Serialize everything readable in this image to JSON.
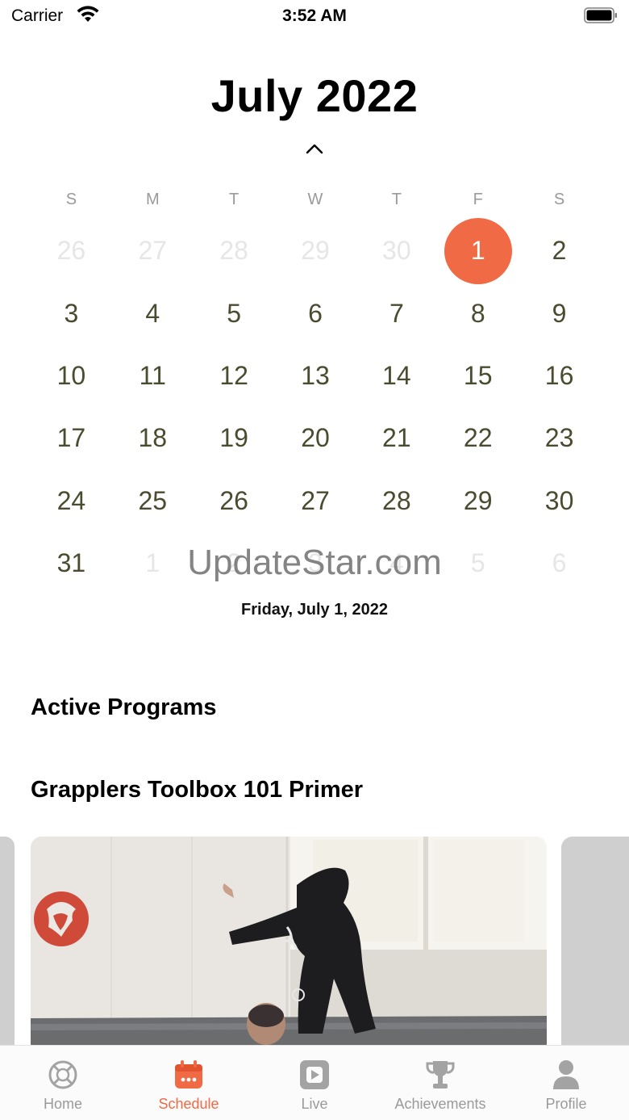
{
  "status_bar": {
    "carrier": "Carrier",
    "time": "3:52 AM"
  },
  "calendar": {
    "month_title": "July 2022",
    "weekdays": [
      "S",
      "M",
      "T",
      "W",
      "T",
      "F",
      "S"
    ],
    "days": [
      {
        "label": "26",
        "in_month": false
      },
      {
        "label": "27",
        "in_month": false
      },
      {
        "label": "28",
        "in_month": false
      },
      {
        "label": "29",
        "in_month": false
      },
      {
        "label": "30",
        "in_month": false
      },
      {
        "label": "1",
        "in_month": true,
        "selected": true
      },
      {
        "label": "2",
        "in_month": true
      },
      {
        "label": "3",
        "in_month": true
      },
      {
        "label": "4",
        "in_month": true
      },
      {
        "label": "5",
        "in_month": true
      },
      {
        "label": "6",
        "in_month": true
      },
      {
        "label": "7",
        "in_month": true
      },
      {
        "label": "8",
        "in_month": true
      },
      {
        "label": "9",
        "in_month": true
      },
      {
        "label": "10",
        "in_month": true
      },
      {
        "label": "11",
        "in_month": true
      },
      {
        "label": "12",
        "in_month": true
      },
      {
        "label": "13",
        "in_month": true
      },
      {
        "label": "14",
        "in_month": true
      },
      {
        "label": "15",
        "in_month": true
      },
      {
        "label": "16",
        "in_month": true
      },
      {
        "label": "17",
        "in_month": true
      },
      {
        "label": "18",
        "in_month": true
      },
      {
        "label": "19",
        "in_month": true
      },
      {
        "label": "20",
        "in_month": true
      },
      {
        "label": "21",
        "in_month": true
      },
      {
        "label": "22",
        "in_month": true
      },
      {
        "label": "23",
        "in_month": true
      },
      {
        "label": "24",
        "in_month": true
      },
      {
        "label": "25",
        "in_month": true
      },
      {
        "label": "26",
        "in_month": true
      },
      {
        "label": "27",
        "in_month": true
      },
      {
        "label": "28",
        "in_month": true
      },
      {
        "label": "29",
        "in_month": true
      },
      {
        "label": "30",
        "in_month": true
      },
      {
        "label": "31",
        "in_month": true
      },
      {
        "label": "1",
        "in_month": false
      },
      {
        "label": "2",
        "in_month": false
      },
      {
        "label": "3",
        "in_month": false
      },
      {
        "label": "4",
        "in_month": false
      },
      {
        "label": "5",
        "in_month": false
      },
      {
        "label": "6",
        "in_month": false
      }
    ],
    "selected_date_text": "Friday, July 1, 2022",
    "collapse_icon": "chevron-up-icon"
  },
  "watermark": "UpdateStar.com",
  "sections": {
    "active_programs_title": "Active Programs",
    "program_title": "Grapplers Toolbox 101 Primer"
  },
  "tab_bar": {
    "tabs": [
      {
        "label": "Home",
        "icon": "home-icon",
        "active": false
      },
      {
        "label": "Schedule",
        "icon": "calendar-icon",
        "active": true
      },
      {
        "label": "Live",
        "icon": "live-play-icon",
        "active": false
      },
      {
        "label": "Achievements",
        "icon": "trophy-icon",
        "active": false
      },
      {
        "label": "Profile",
        "icon": "person-icon",
        "active": false
      }
    ]
  },
  "colors": {
    "accent": "#ef6a45",
    "day_text": "#4b4b30",
    "muted_day": "#e6e6e6",
    "tab_inactive": "#9a9a9a"
  }
}
